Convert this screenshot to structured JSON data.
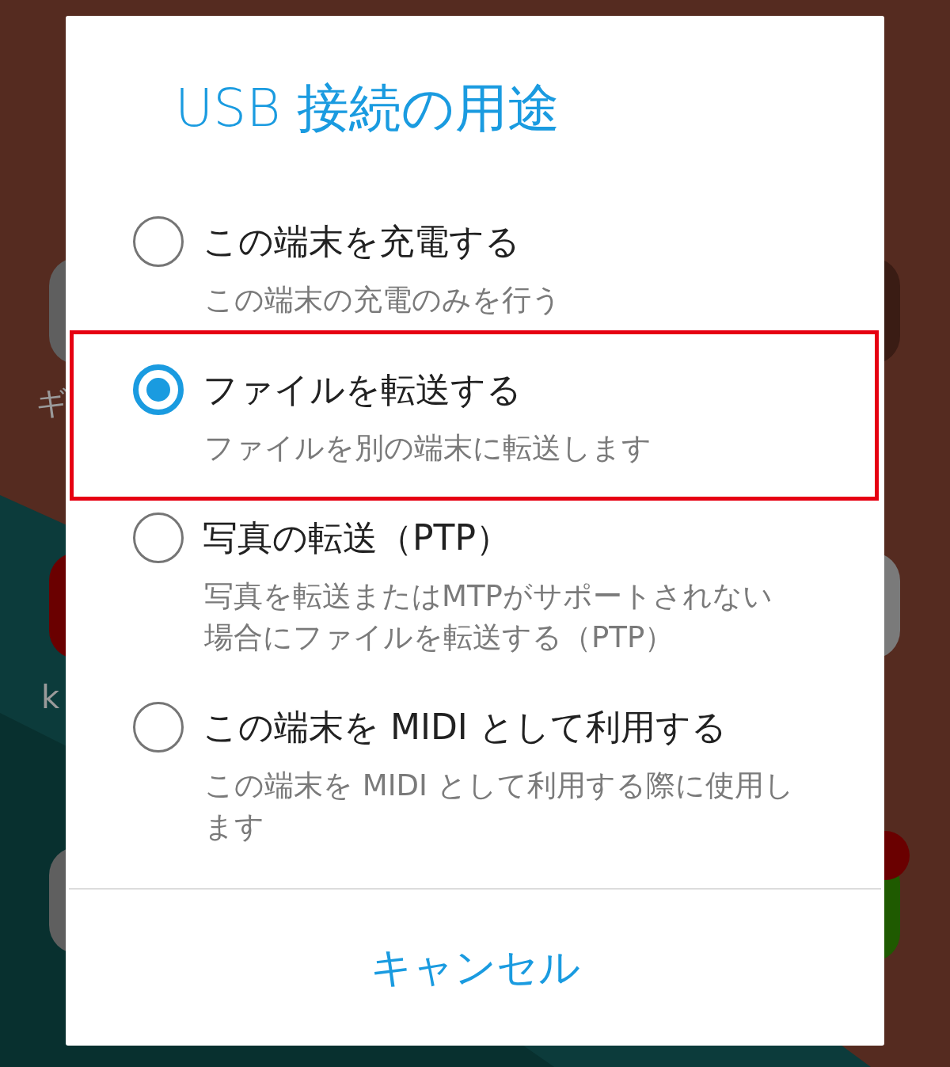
{
  "home_screen": {
    "labels": [
      {
        "text": "ギ"
      },
      {
        "text": "k"
      }
    ],
    "icons": [
      {
        "color": "#5f5f5f"
      },
      {
        "color": "#6a0000"
      },
      {
        "color": "#5f5f5f"
      },
      {
        "color": "#3a1c14"
      },
      {
        "color": "#7a7a7a"
      },
      {
        "color": "#1f5a00"
      }
    ]
  },
  "dialog": {
    "title": "USB 接続の用途",
    "options": [
      {
        "label": "この端末を充電する",
        "description": "この端末の充電のみを行う",
        "selected": false,
        "highlighted": false
      },
      {
        "label": "ファイルを転送する",
        "description": "ファイルを別の端末に転送します",
        "selected": true,
        "highlighted": true
      },
      {
        "label": "写真の転送（PTP）",
        "description": "写真を転送またはMTPがサポートされない場合にファイルを転送する（PTP）",
        "selected": false,
        "highlighted": false
      },
      {
        "label": "この端末を MIDI として利用する",
        "description": "この端末を MIDI として利用する際に使用します",
        "selected": false,
        "highlighted": false
      }
    ],
    "cancel_button": "キャンセル"
  }
}
